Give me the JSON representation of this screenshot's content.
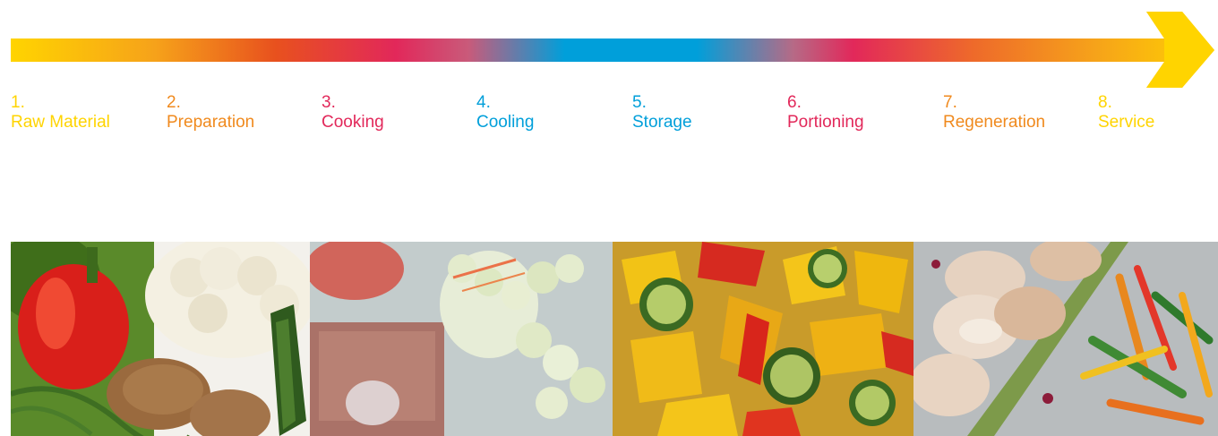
{
  "colors": {
    "yellow": "#FFD400",
    "orange": "#F08A1E",
    "pink": "#E2285A",
    "blue": "#009FDA"
  },
  "steps": [
    {
      "number": "1.",
      "label": "Raw Material",
      "color": "#FFD400"
    },
    {
      "number": "2.",
      "label": "Preparation",
      "color": "#F08A1E"
    },
    {
      "number": "3.",
      "label": "Cooking",
      "color": "#E2285A"
    },
    {
      "number": "4.",
      "label": "Cooling",
      "color": "#009FDA"
    },
    {
      "number": "5.",
      "label": "Storage",
      "color": "#009FDA"
    },
    {
      "number": "6.",
      "label": "Portioning",
      "color": "#E2285A"
    },
    {
      "number": "7.",
      "label": "Regeneration",
      "color": "#F08A1E"
    },
    {
      "number": "8.",
      "label": "Service",
      "color": "#FFD400"
    }
  ],
  "photos": [
    {
      "subject": "raw-vegetables-photo"
    },
    {
      "subject": "vacuum-packed-vegetables-photo"
    },
    {
      "subject": "cooked-vegetables-photo"
    },
    {
      "subject": "plated-meat-and-vegetables-photo"
    }
  ]
}
